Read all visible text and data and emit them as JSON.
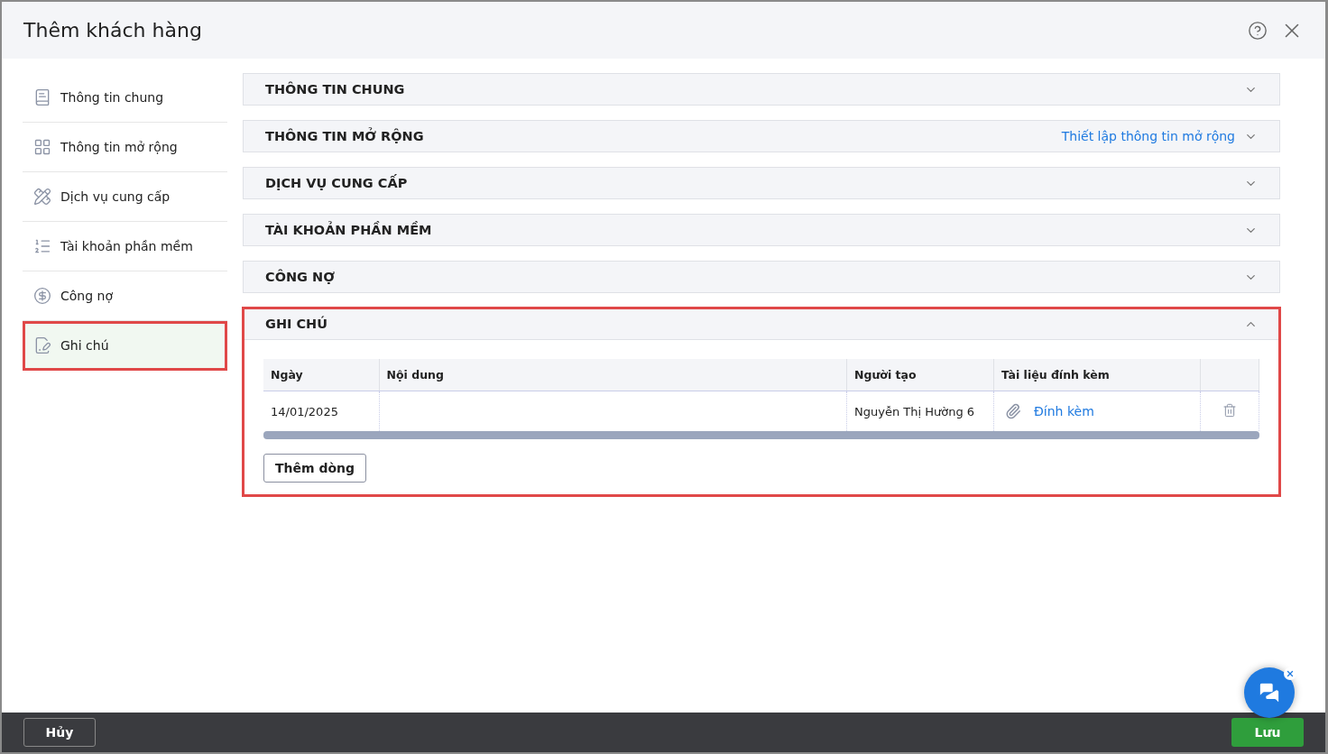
{
  "window": {
    "title": "Thêm khách hàng"
  },
  "sidebar": {
    "items": [
      {
        "label": "Thông tin chung",
        "selected": false,
        "highlighted": false
      },
      {
        "label": "Thông tin mở rộng",
        "selected": false,
        "highlighted": false
      },
      {
        "label": "Dịch vụ cung cấp",
        "selected": false,
        "highlighted": false
      },
      {
        "label": "Tài khoản phần mềm",
        "selected": false,
        "highlighted": false
      },
      {
        "label": "Công nợ",
        "selected": false,
        "highlighted": false
      },
      {
        "label": "Ghi chú",
        "selected": true,
        "highlighted": true
      }
    ]
  },
  "sections": [
    {
      "title": "THÔNG TIN CHUNG",
      "expanded": false,
      "highlighted": false
    },
    {
      "title": "THÔNG TIN MỞ RỘNG",
      "expanded": false,
      "highlighted": false,
      "link": "Thiết lập thông tin mở rộng"
    },
    {
      "title": "DỊCH VỤ CUNG CẤP",
      "expanded": false,
      "highlighted": false
    },
    {
      "title": "TÀI KHOẢN PHẦN MỀM",
      "expanded": false,
      "highlighted": false
    },
    {
      "title": "CÔNG NỢ",
      "expanded": false,
      "highlighted": false
    },
    {
      "title": "GHI CHÚ",
      "expanded": true,
      "highlighted": true,
      "table": {
        "columns": [
          "Ngày",
          "Nội dung",
          "Người tạo",
          "Tài liệu đính kèm"
        ],
        "rows": [
          {
            "date": "14/01/2025",
            "content": "",
            "creator": "Nguyễn Thị Hường 6",
            "attachment": "Đính kèm"
          }
        ]
      },
      "add_button": "Thêm dòng"
    }
  ],
  "footer": {
    "cancel": "Hủy",
    "save": "Lưu"
  }
}
